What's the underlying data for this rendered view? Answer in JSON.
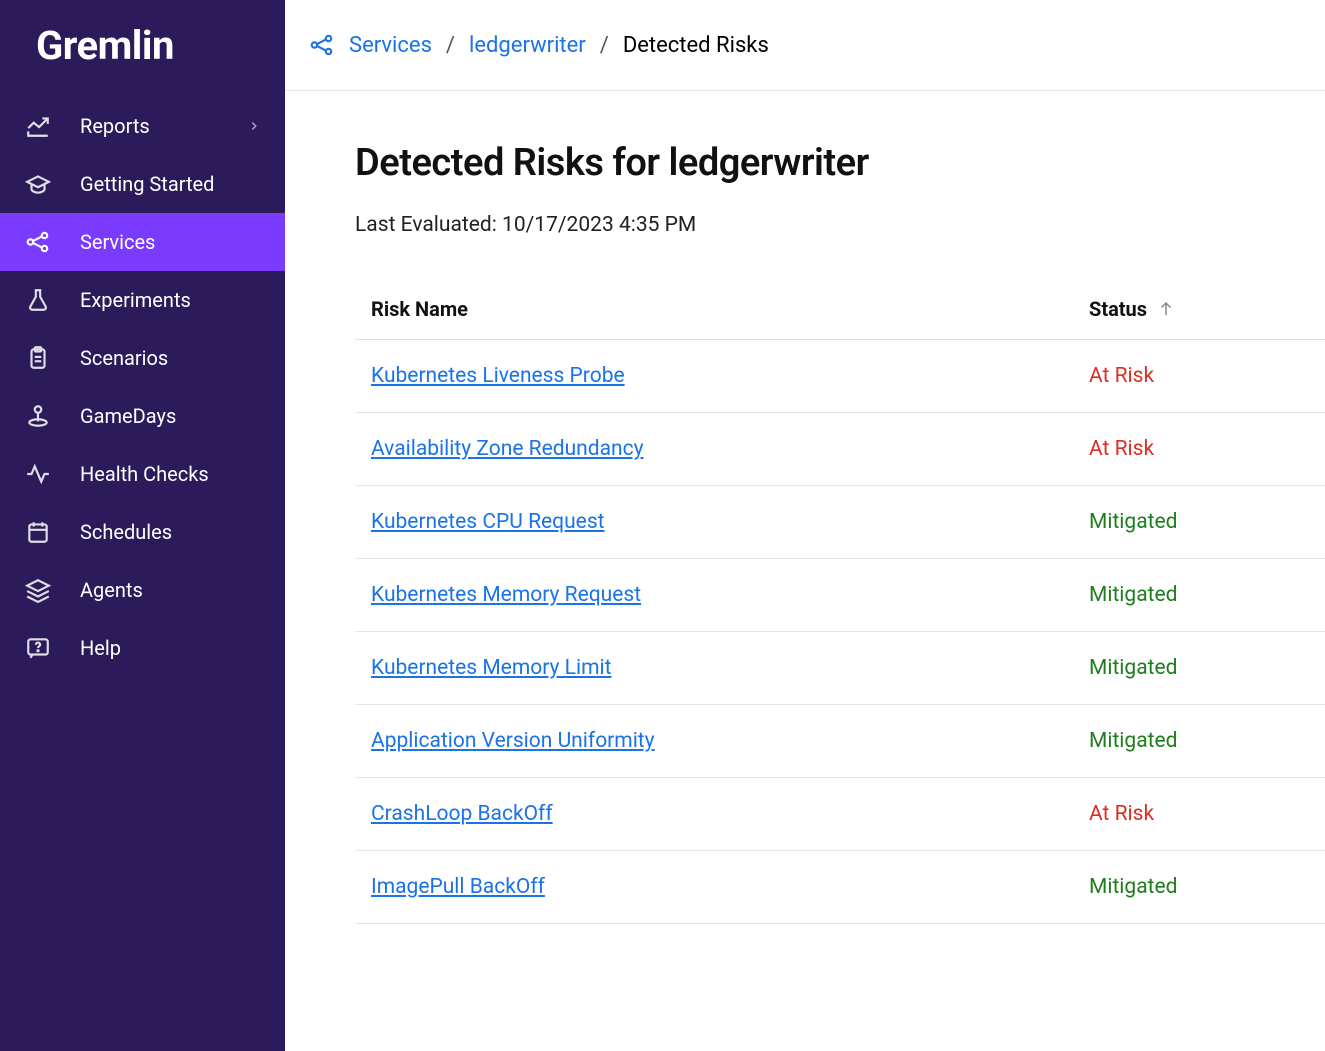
{
  "logo": "Gremlin",
  "sidebar": {
    "items": [
      {
        "label": "Reports",
        "icon": "chart-line-icon",
        "hasChevron": true
      },
      {
        "label": "Getting Started",
        "icon": "graduation-cap-icon"
      },
      {
        "label": "Services",
        "icon": "network-icon",
        "active": true
      },
      {
        "label": "Experiments",
        "icon": "flask-icon"
      },
      {
        "label": "Scenarios",
        "icon": "clipboard-icon"
      },
      {
        "label": "GameDays",
        "icon": "joystick-icon"
      },
      {
        "label": "Health Checks",
        "icon": "pulse-icon"
      },
      {
        "label": "Schedules",
        "icon": "calendar-icon"
      },
      {
        "label": "Agents",
        "icon": "layers-icon"
      },
      {
        "label": "Help",
        "icon": "help-icon"
      }
    ]
  },
  "breadcrumb": {
    "services": "Services",
    "service": "ledgerwriter",
    "current": "Detected Risks"
  },
  "page": {
    "title": "Detected Risks for ledgerwriter",
    "lastEvaluated": "Last Evaluated: 10/17/2023 4:35 PM"
  },
  "table": {
    "headers": {
      "name": "Risk Name",
      "status": "Status"
    },
    "rows": [
      {
        "name": "Kubernetes Liveness Probe",
        "status": "At Risk",
        "statusClass": "atrisk"
      },
      {
        "name": "Availability Zone Redundancy",
        "status": "At Risk",
        "statusClass": "atrisk"
      },
      {
        "name": "Kubernetes CPU Request",
        "status": "Mitigated",
        "statusClass": "mitigated"
      },
      {
        "name": "Kubernetes Memory Request",
        "status": "Mitigated",
        "statusClass": "mitigated"
      },
      {
        "name": "Kubernetes Memory Limit",
        "status": "Mitigated",
        "statusClass": "mitigated"
      },
      {
        "name": "Application Version Uniformity",
        "status": "Mitigated",
        "statusClass": "mitigated"
      },
      {
        "name": "CrashLoop BackOff",
        "status": "At Risk",
        "statusClass": "atrisk"
      },
      {
        "name": "ImagePull BackOff",
        "status": "Mitigated",
        "statusClass": "mitigated"
      }
    ]
  }
}
